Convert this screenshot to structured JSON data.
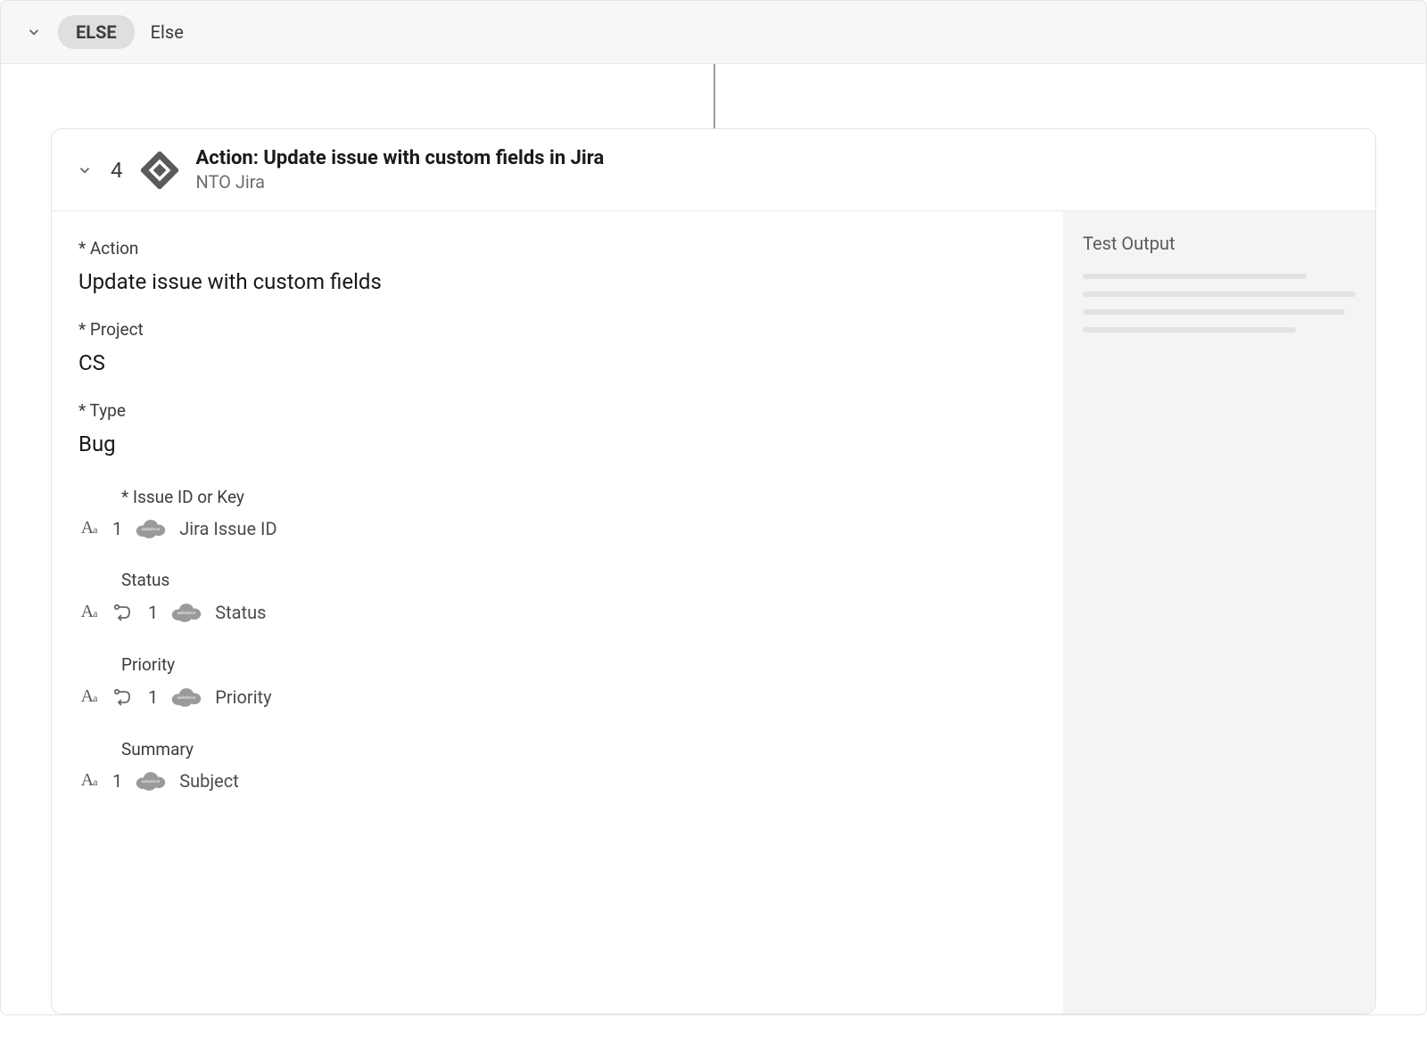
{
  "else_bar": {
    "pill": "ELSE",
    "label": "Else"
  },
  "card": {
    "step": "4",
    "title": "Action: Update issue with custom fields in Jira",
    "subtitle": "NTO Jira"
  },
  "fields": {
    "action": {
      "label": "* Action",
      "value": "Update issue with custom fields"
    },
    "project": {
      "label": "* Project",
      "value": "CS"
    },
    "type": {
      "label": "* Type",
      "value": "Bug"
    },
    "issue_id": {
      "label": "* Issue ID or Key",
      "step": "1",
      "mapped": "Jira Issue ID"
    },
    "status": {
      "label": "Status",
      "step": "1",
      "mapped": "Status"
    },
    "priority": {
      "label": "Priority",
      "step": "1",
      "mapped": "Priority"
    },
    "summary": {
      "label": "Summary",
      "step": "1",
      "mapped": "Subject"
    }
  },
  "right": {
    "title": "Test Output"
  }
}
